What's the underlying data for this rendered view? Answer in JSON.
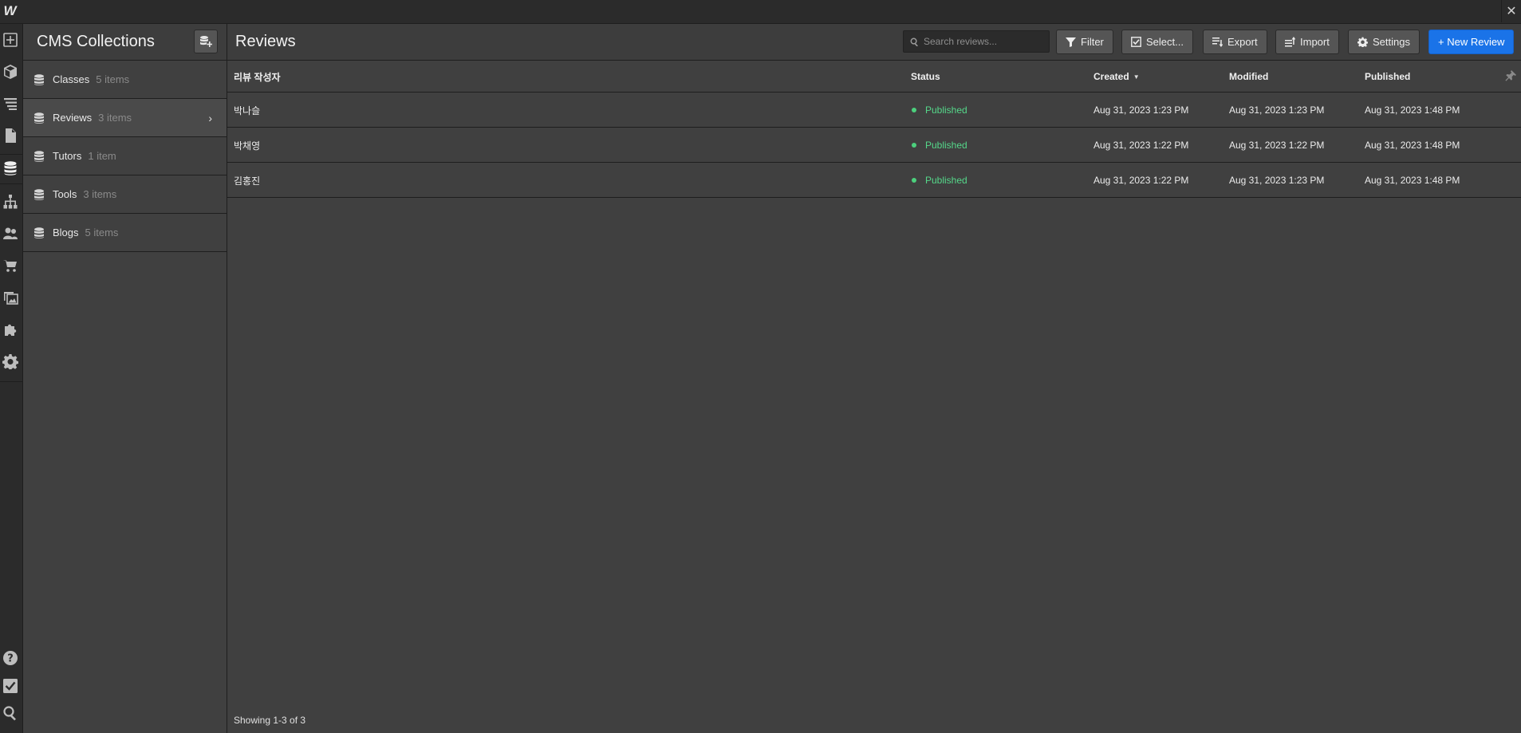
{
  "app": {
    "logo_text": "W",
    "close_glyph": "✕"
  },
  "rail": {
    "icons": [
      "add-icon",
      "box-icon",
      "navigator-icon",
      "pages-icon",
      "cms-icon",
      "logic-icon",
      "users-icon",
      "ecommerce-icon",
      "assets-icon",
      "apps-icon",
      "settings-icon",
      "help-icon",
      "checklist-icon",
      "search-icon",
      "video-icon"
    ]
  },
  "panel": {
    "title": "CMS Collections",
    "collections": [
      {
        "name": "Classes",
        "count": "5 items"
      },
      {
        "name": "Reviews",
        "count": "3 items"
      },
      {
        "name": "Tutors",
        "count": "1 item"
      },
      {
        "name": "Tools",
        "count": "3 items"
      },
      {
        "name": "Blogs",
        "count": "5 items"
      }
    ],
    "active_index": 1,
    "chevron": "›"
  },
  "main": {
    "title": "Reviews",
    "search_placeholder": "Search reviews...",
    "buttons": {
      "filter": "Filter",
      "select": "Select...",
      "export": "Export",
      "import": "Import",
      "settings": "Settings",
      "new": "+ New Review"
    },
    "table": {
      "columns": [
        "리뷰 작성자",
        "Status",
        "Created",
        "Modified",
        "Published"
      ],
      "sort_indicator": "▼",
      "rows": [
        {
          "author": "박나슬",
          "status": "Published",
          "created": "Aug 31, 2023 1:23 PM",
          "modified": "Aug 31, 2023 1:23 PM",
          "published": "Aug 31, 2023 1:48 PM"
        },
        {
          "author": "박채영",
          "status": "Published",
          "created": "Aug 31, 2023 1:22 PM",
          "modified": "Aug 31, 2023 1:22 PM",
          "published": "Aug 31, 2023 1:48 PM"
        },
        {
          "author": "김홍진",
          "status": "Published",
          "created": "Aug 31, 2023 1:22 PM",
          "modified": "Aug 31, 2023 1:23 PM",
          "published": "Aug 31, 2023 1:48 PM"
        }
      ]
    },
    "footer": "Showing 1-3 of 3"
  },
  "colors": {
    "accent": "#1a73e8",
    "published": "#55d88a",
    "bg": "#404040",
    "rail": "#2b2b2b"
  }
}
